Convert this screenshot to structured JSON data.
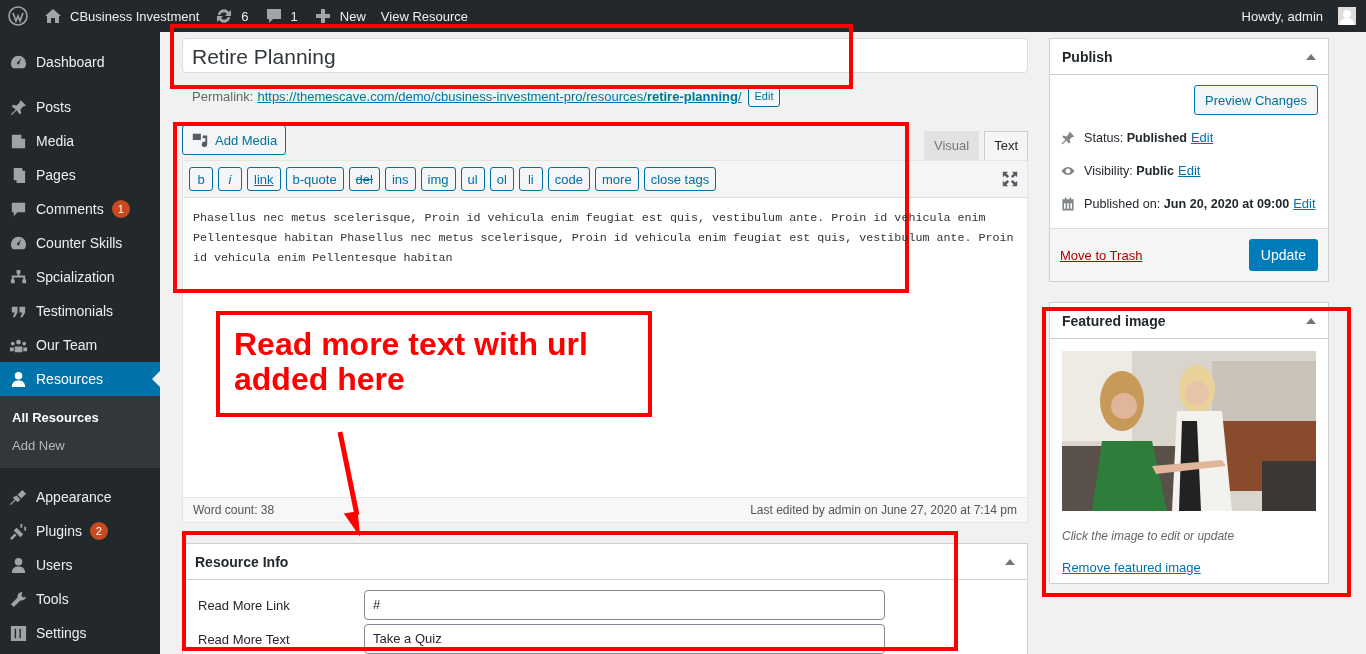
{
  "admin_bar": {
    "site": "CBusiness Investment",
    "updates": "6",
    "comments": "1",
    "new": "New",
    "view": "View Resource",
    "greeting": "Howdy, admin"
  },
  "sidebar": {
    "items": [
      {
        "label": "Dashboard",
        "selected": false
      },
      {
        "label": "Posts",
        "selected": false
      },
      {
        "label": "Media",
        "selected": false
      },
      {
        "label": "Pages",
        "selected": false
      },
      {
        "label": "Comments",
        "selected": false,
        "badge": "1"
      },
      {
        "label": "Counter Skills",
        "selected": false
      },
      {
        "label": "Spcialization",
        "selected": false
      },
      {
        "label": "Testimonials",
        "selected": false
      },
      {
        "label": "Our Team",
        "selected": false
      },
      {
        "label": "Resources",
        "selected": true,
        "children": [
          {
            "label": "All Resources",
            "selected": true
          },
          {
            "label": "Add New",
            "selected": false
          }
        ]
      },
      {
        "label": "Appearance",
        "selected": false
      },
      {
        "label": "Plugins",
        "selected": false,
        "badge": "2"
      },
      {
        "label": "Users",
        "selected": false
      },
      {
        "label": "Tools",
        "selected": false
      },
      {
        "label": "Settings",
        "selected": false
      }
    ]
  },
  "title": "Retire Planning",
  "permalink": {
    "label": "Permalink:",
    "url": "https://themescave.com/demo/cbusiness-investment-pro/resources/**retire-planning**/",
    "button": "Edit"
  },
  "editor": {
    "add_media": "Add Media",
    "tabs": [
      {
        "label": "Visual",
        "selected": false
      },
      {
        "label": "Text",
        "selected": true
      }
    ],
    "quicktags": [
      {
        "label": "b",
        "kind": "plain"
      },
      {
        "label": "i",
        "kind": "italic"
      },
      {
        "label": "link",
        "kind": "underline"
      },
      {
        "label": "b-quote",
        "kind": "plain"
      },
      {
        "label": "del",
        "kind": "strike"
      },
      {
        "label": "ins",
        "kind": "plain"
      },
      {
        "label": "img",
        "kind": "plain"
      },
      {
        "label": "ul",
        "kind": "plain"
      },
      {
        "label": "ol",
        "kind": "plain"
      },
      {
        "label": "li",
        "kind": "plain"
      },
      {
        "label": "code",
        "kind": "plain"
      },
      {
        "label": "more",
        "kind": "plain"
      },
      {
        "label": "close tags",
        "kind": "plain"
      }
    ],
    "content": "Phasellus nec metus scelerisque, Proin id vehicula enim feugiat est quis, vestibulum ante. Proin id vehicula enim Pellentesque habitan Phasellus nec metus scelerisque, Proin id vehicula enim feugiat est quis, vestibulum ante. Proin id vehicula enim Pellentesque habitan",
    "word_count": "Word count: 38",
    "last_edited": "Last edited by admin on June 27, 2020 at 7:14 pm"
  },
  "resource_info": {
    "title": "Resource Info",
    "fields": [
      {
        "label": "Read More Link",
        "value": "#"
      },
      {
        "label": "Read More Text",
        "value": "Take a Quiz"
      }
    ]
  },
  "publish": {
    "title": "Publish",
    "preview": "Preview Changes",
    "rows": [
      {
        "text": "Status: **Published**",
        "edit": "Edit"
      },
      {
        "text": "Visibility: **Public**",
        "edit": "Edit"
      },
      {
        "text": "Published on: **Jun 20, 2020 at 09:00**",
        "edit": "Edit"
      }
    ],
    "trash": "Move to Trash",
    "update": "Update"
  },
  "featured_image": {
    "title": "Featured image",
    "caption": "Click the image to edit or update",
    "remove": "Remove featured image"
  },
  "annotation": {
    "callout": "Read more text with url added here"
  }
}
